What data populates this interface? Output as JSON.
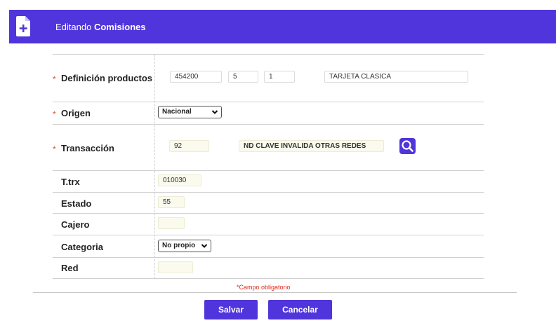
{
  "header": {
    "prefix": "Editando",
    "entity": "Comisiones",
    "icon": "file-add-icon"
  },
  "form": {
    "required_mark": "*",
    "fields": {
      "definicion": {
        "label": "Definición productos",
        "code1": "454200",
        "code2": "5",
        "code3": "1",
        "description": "TARJETA CLASICA"
      },
      "origen": {
        "label": "Origen",
        "selected": "Nacional"
      },
      "transaccion": {
        "label": "Transacción",
        "code": "92",
        "description": "ND CLAVE INVALIDA OTRAS REDES"
      },
      "ttrx": {
        "label": "T.trx",
        "value": "010030"
      },
      "estado": {
        "label": "Estado",
        "value": "55"
      },
      "cajero": {
        "label": "Cajero",
        "value": ""
      },
      "categoria": {
        "label": "Categoria",
        "selected": "No propio"
      },
      "red": {
        "label": "Red",
        "value": ""
      }
    },
    "required_note": "Campo obligatorio"
  },
  "actions": {
    "save_label": "Salvar",
    "cancel_label": "Cancelar"
  },
  "colors": {
    "accent": "#4f35db",
    "required": "#e0541a",
    "field_tint": "#fafbed"
  }
}
